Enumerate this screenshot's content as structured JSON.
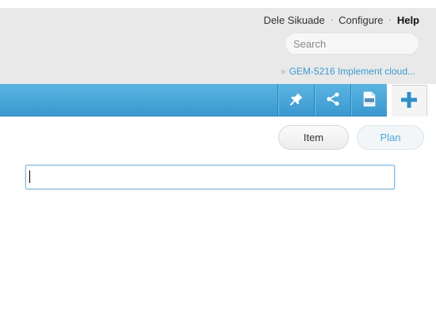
{
  "header": {
    "user_name": "Dele Sikuade",
    "separator": "·",
    "configure_label": "Configure",
    "help_label": "Help",
    "search": {
      "placeholder": "Search",
      "value": ""
    },
    "breadcrumb": {
      "prefix": "»",
      "text": "GEM-5216 Implement cloud..."
    }
  },
  "toolbar": {
    "buttons": [
      {
        "name": "pin",
        "icon": "pin-icon"
      },
      {
        "name": "share",
        "icon": "share-icon"
      },
      {
        "name": "pdf",
        "icon": "pdf-icon"
      }
    ],
    "add_icon": "plus-icon",
    "accent": "#3a98cf"
  },
  "actions": {
    "item_label": "Item",
    "plan_label": "Plan"
  },
  "editor": {
    "value": ""
  }
}
